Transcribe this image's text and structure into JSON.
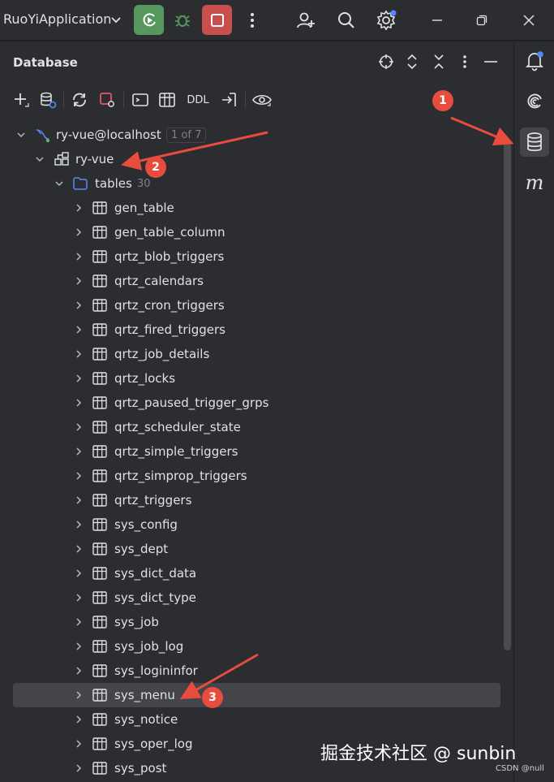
{
  "titlebar": {
    "app_name": "RuoYiApplication",
    "icons": [
      "run-icon",
      "debug-icon",
      "stop-icon",
      "more-icon",
      "add-user-icon",
      "search-icon",
      "settings-icon",
      "minimize-icon",
      "restore-icon",
      "close-icon"
    ]
  },
  "panel": {
    "title": "Database",
    "header_icons": [
      "locate-icon",
      "expand-icon",
      "collapse-icon",
      "more-icon",
      "hide-icon"
    ],
    "toolbar": {
      "ddl_label": "DDL",
      "icons": [
        "add-icon",
        "data-source-properties-icon",
        "refresh-icon",
        "stop-icon",
        "console-icon",
        "table-icon",
        "jump-icon",
        "view-icon"
      ]
    }
  },
  "tree": {
    "connection": {
      "label": "ry-vue@localhost",
      "badge": "1 of 7"
    },
    "schema": {
      "label": "ry-vue"
    },
    "folder": {
      "label": "tables",
      "count": "30"
    },
    "tables": [
      "gen_table",
      "gen_table_column",
      "qrtz_blob_triggers",
      "qrtz_calendars",
      "qrtz_cron_triggers",
      "qrtz_fired_triggers",
      "qrtz_job_details",
      "qrtz_locks",
      "qrtz_paused_trigger_grps",
      "qrtz_scheduler_state",
      "qrtz_simple_triggers",
      "qrtz_simprop_triggers",
      "qrtz_triggers",
      "sys_config",
      "sys_dept",
      "sys_dict_data",
      "sys_dict_type",
      "sys_job",
      "sys_job_log",
      "sys_logininfor",
      "sys_menu",
      "sys_notice",
      "sys_oper_log",
      "sys_post"
    ],
    "selected_table": "sys_menu"
  },
  "strip": {
    "icons": [
      "notifications-icon",
      "ai-assistant-icon",
      "database-icon",
      "maven-icon"
    ],
    "maven_label": "m"
  },
  "annotations": {
    "markers": [
      "1",
      "2",
      "3"
    ],
    "color": "#e84c3d"
  },
  "watermark": {
    "main": "掘金技术社区 @ sunbin",
    "sub": "CSDN @null"
  },
  "colors": {
    "background": "#2b2d30",
    "run": "#57965c",
    "stop": "#c94f4f",
    "selection": "#43454a",
    "folder": "#548af7"
  }
}
